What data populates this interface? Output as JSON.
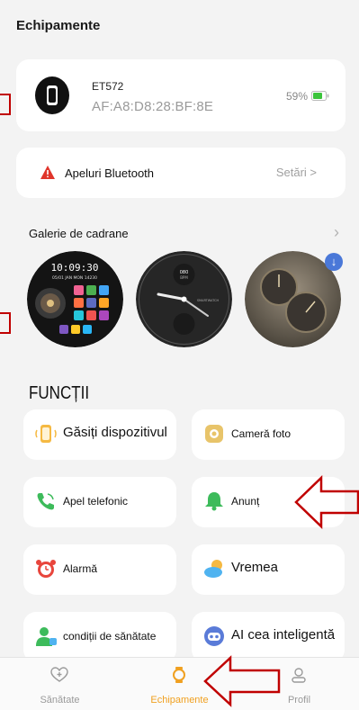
{
  "header": {
    "title": "Echipamente"
  },
  "device": {
    "name": "ET572",
    "mac": "AF:A8:D8:28:BF:8E",
    "battery": "59%"
  },
  "bluetooth": {
    "label": "Apeluri Bluetooth",
    "settings": "Setări >"
  },
  "gallery": {
    "title": "Galerie de cadrane",
    "face1_time": "10:09:30",
    "face1_date": "05/01 JAN MON 14230",
    "face2_top": "080",
    "face2_unit": "BPM",
    "face2_brand": "SMARTWATCH"
  },
  "functions": {
    "title": "FUNCȚII",
    "items": [
      {
        "label": "Găsiți dispozitivul",
        "icon": "find-device-icon"
      },
      {
        "label": "Cameră foto",
        "icon": "camera-icon"
      },
      {
        "label": "Apel telefonic",
        "icon": "phone-icon"
      },
      {
        "label": "Anunț",
        "icon": "notification-bell-icon"
      },
      {
        "label": "Alarmă",
        "icon": "alarm-clock-icon"
      },
      {
        "label": "Vremea",
        "icon": "weather-icon"
      },
      {
        "label": "condiții de sănătate",
        "icon": "health-icon"
      },
      {
        "label": "AI cea inteligentă",
        "icon": "ai-robot-icon"
      }
    ]
  },
  "nav": {
    "items": [
      {
        "label": "Sănătate",
        "icon": "health-heart-icon"
      },
      {
        "label": "Echipamente",
        "icon": "watch-icon"
      },
      {
        "label": "Profil",
        "icon": "profile-icon"
      }
    ],
    "active": "Echipamente"
  },
  "colors": {
    "accent": "#f0a020",
    "annotation": "#c00000",
    "battery": "#3cc43c",
    "download_badge": "#4a78d8"
  }
}
